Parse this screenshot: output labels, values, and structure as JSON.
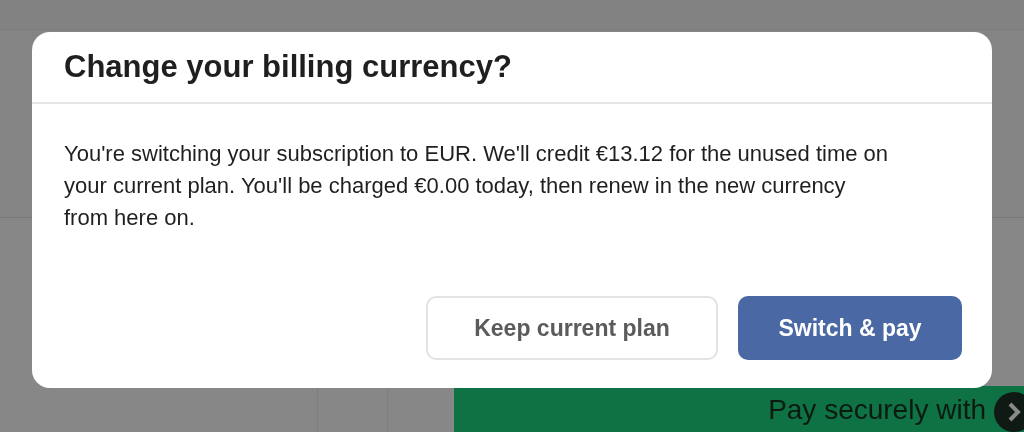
{
  "dialog": {
    "title": "Change your billing currency?",
    "message": "You're switching your subscription to EUR. We'll credit €13.12 for the unused time on your current plan. You'll be charged €0.00 today, then renew in the new currency from here on.",
    "buttons": [
      {
        "label": "Keep current plan",
        "kind": "secondary"
      },
      {
        "label": "Switch & pay",
        "kind": "primary"
      }
    ]
  },
  "background": {
    "pay_button": {
      "label": "Pay securely with"
    }
  }
}
